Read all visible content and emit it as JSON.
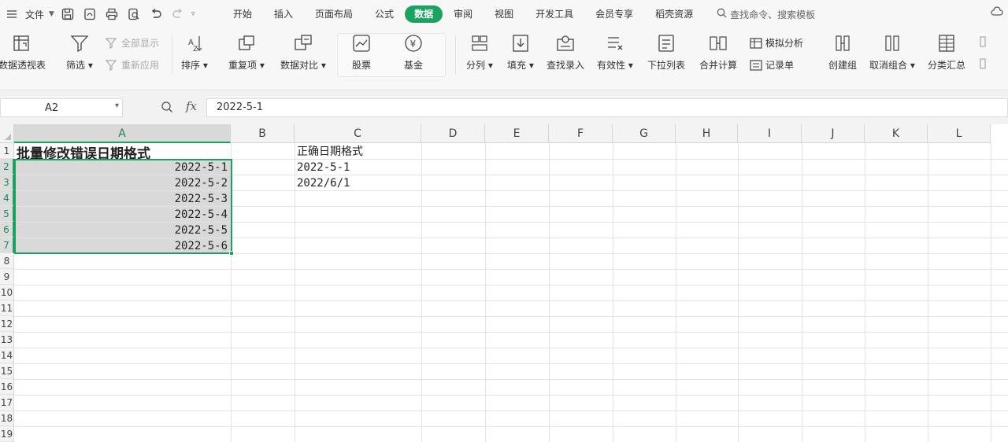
{
  "app": {
    "accent": "#1aa260"
  },
  "menubar": {
    "file_label": "文件",
    "tabs": [
      "开始",
      "插入",
      "页面布局",
      "公式",
      "数据",
      "审阅",
      "视图",
      "开发工具",
      "会员专享",
      "稻壳资源"
    ],
    "active_tab": "数据",
    "search_placeholder": "查找命令、搜索模板"
  },
  "ribbon": {
    "pivot": "数据透视表",
    "filter": "筛选",
    "show_all": "全部显示",
    "reapply": "重新应用",
    "sort": "排序",
    "duplicates": "重复项",
    "compare": "数据对比",
    "stock": "股票",
    "fund": "基金",
    "split": "分列",
    "fill": "填充",
    "lookup": "查找录入",
    "validity": "有效性",
    "dropdown": "下拉列表",
    "consolidate": "合并计算",
    "simulate": "模拟分析",
    "record": "记录单",
    "group": "创建组",
    "ungroup": "取消组合",
    "subtotal": "分类汇总"
  },
  "formula_bar": {
    "name_box": "A2",
    "fx_label": "fx",
    "formula": "2022-5-1"
  },
  "sheet": {
    "columns": [
      "A",
      "B",
      "C",
      "D",
      "E",
      "F",
      "G",
      "H",
      "I",
      "J",
      "K",
      "L"
    ],
    "selected_column": "A",
    "rows": [
      "1",
      "2",
      "3",
      "4",
      "5",
      "6",
      "7",
      "8",
      "9",
      "10",
      "11",
      "12",
      "13",
      "14",
      "15",
      "16",
      "17",
      "18",
      "19"
    ],
    "cells": {
      "A1": "批量修改错误日期格式",
      "A2": "2022-5-1",
      "A3": "2022-5-2",
      "A4": "2022-5-3",
      "A5": "2022-5-4",
      "A6": "2022-5-5",
      "A7": "2022-5-6",
      "C1": "正确日期格式",
      "C2": "2022-5-1",
      "C3": "2022/6/1"
    },
    "selection": "A2:A7"
  }
}
